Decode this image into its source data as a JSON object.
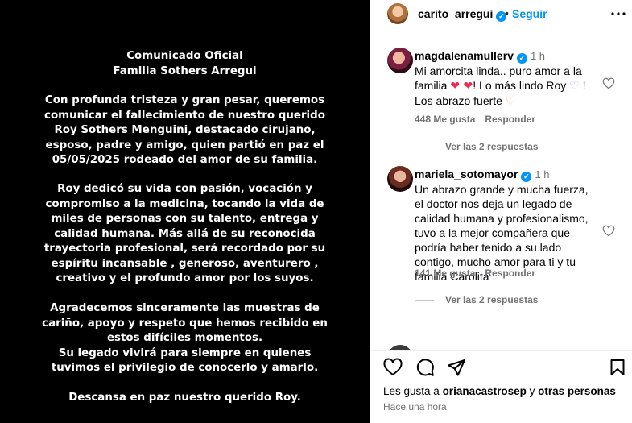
{
  "post_image": {
    "title_lines": [
      "Comunicado Oficial",
      "Familia Sothers Arregui"
    ],
    "p1_lines": [
      "Con profunda tristeza y gran pesar, queremos",
      "comunicar el fallecimiento de nuestro querido",
      "Roy Sothers Menguini, destacado cirujano,",
      "esposo, padre y amigo, quien partió en paz el",
      "05/05/2025 rodeado del amor de su familia."
    ],
    "p2_lines": [
      "Roy dedicó su vida con pasión, vocación y",
      "compromiso a la medicina, tocando la vida de",
      "miles de personas con su talento, entrega y",
      "calidad humana. Más allá de su reconocida",
      "trayectoria profesional, será recordado por su",
      "espíritu incansable , generoso, aventurero ,",
      "creativo y el profundo amor por los suyos."
    ],
    "p3_lines": [
      "Agradecemos sinceramente las muestras de",
      "cariño, apoyo y respeto que hemos recibido en",
      "estos difíciles momentos.",
      "Su legado vivirá para siempre en quienes",
      "tuvimos el privilegio de conocerlo y amarlo."
    ],
    "p4_lines": [
      "Descansa en paz nuestro querido Roy."
    ]
  },
  "header": {
    "username": "carito_arregui",
    "dot": "•",
    "follow_label": "Seguir"
  },
  "comments": [
    {
      "username": "magdalenamullerv",
      "time": "1 h",
      "text_a": "Mi amorcita linda.. puro amor a la familia ",
      "emoji_a": "❤ ❤",
      "text_b": "! Lo más lindo Roy ",
      "emoji_b": "♡",
      "text_c": " ! Los abrazo fuerte ",
      "emoji_c": "♡",
      "likes": "448 Me gusta",
      "reply": "Responder",
      "view_replies": "Ver las 2 respuestas"
    },
    {
      "username": "mariela_sotomayor",
      "time": "1 h",
      "text_a": "Un abrazo grande y mucha fuerza, el doctor nos deja un legado de calidad humana y profesionalismo, tuvo a la mejor compañera que podría haber tenido a su lado contigo, mucho amor para ti y tu familia Carolita",
      "emoji_a": "♡",
      "likes": "141 Me gusta",
      "reply": "Responder",
      "view_replies": "Ver las 2 respuestas"
    }
  ],
  "footer": {
    "likes_prefix": "Les gusta a ",
    "likes_user": "orianacastrosep",
    "likes_mid": " y ",
    "likes_others": "otras personas",
    "time_ago": "Hace una hora"
  },
  "icons": [
    "more-icon",
    "heart-icon",
    "comment-icon",
    "share-icon",
    "save-icon",
    "verified-icon"
  ],
  "colors": {
    "accent": "#0095f6",
    "muted": "#737373",
    "heart": "#ed2a4f"
  }
}
